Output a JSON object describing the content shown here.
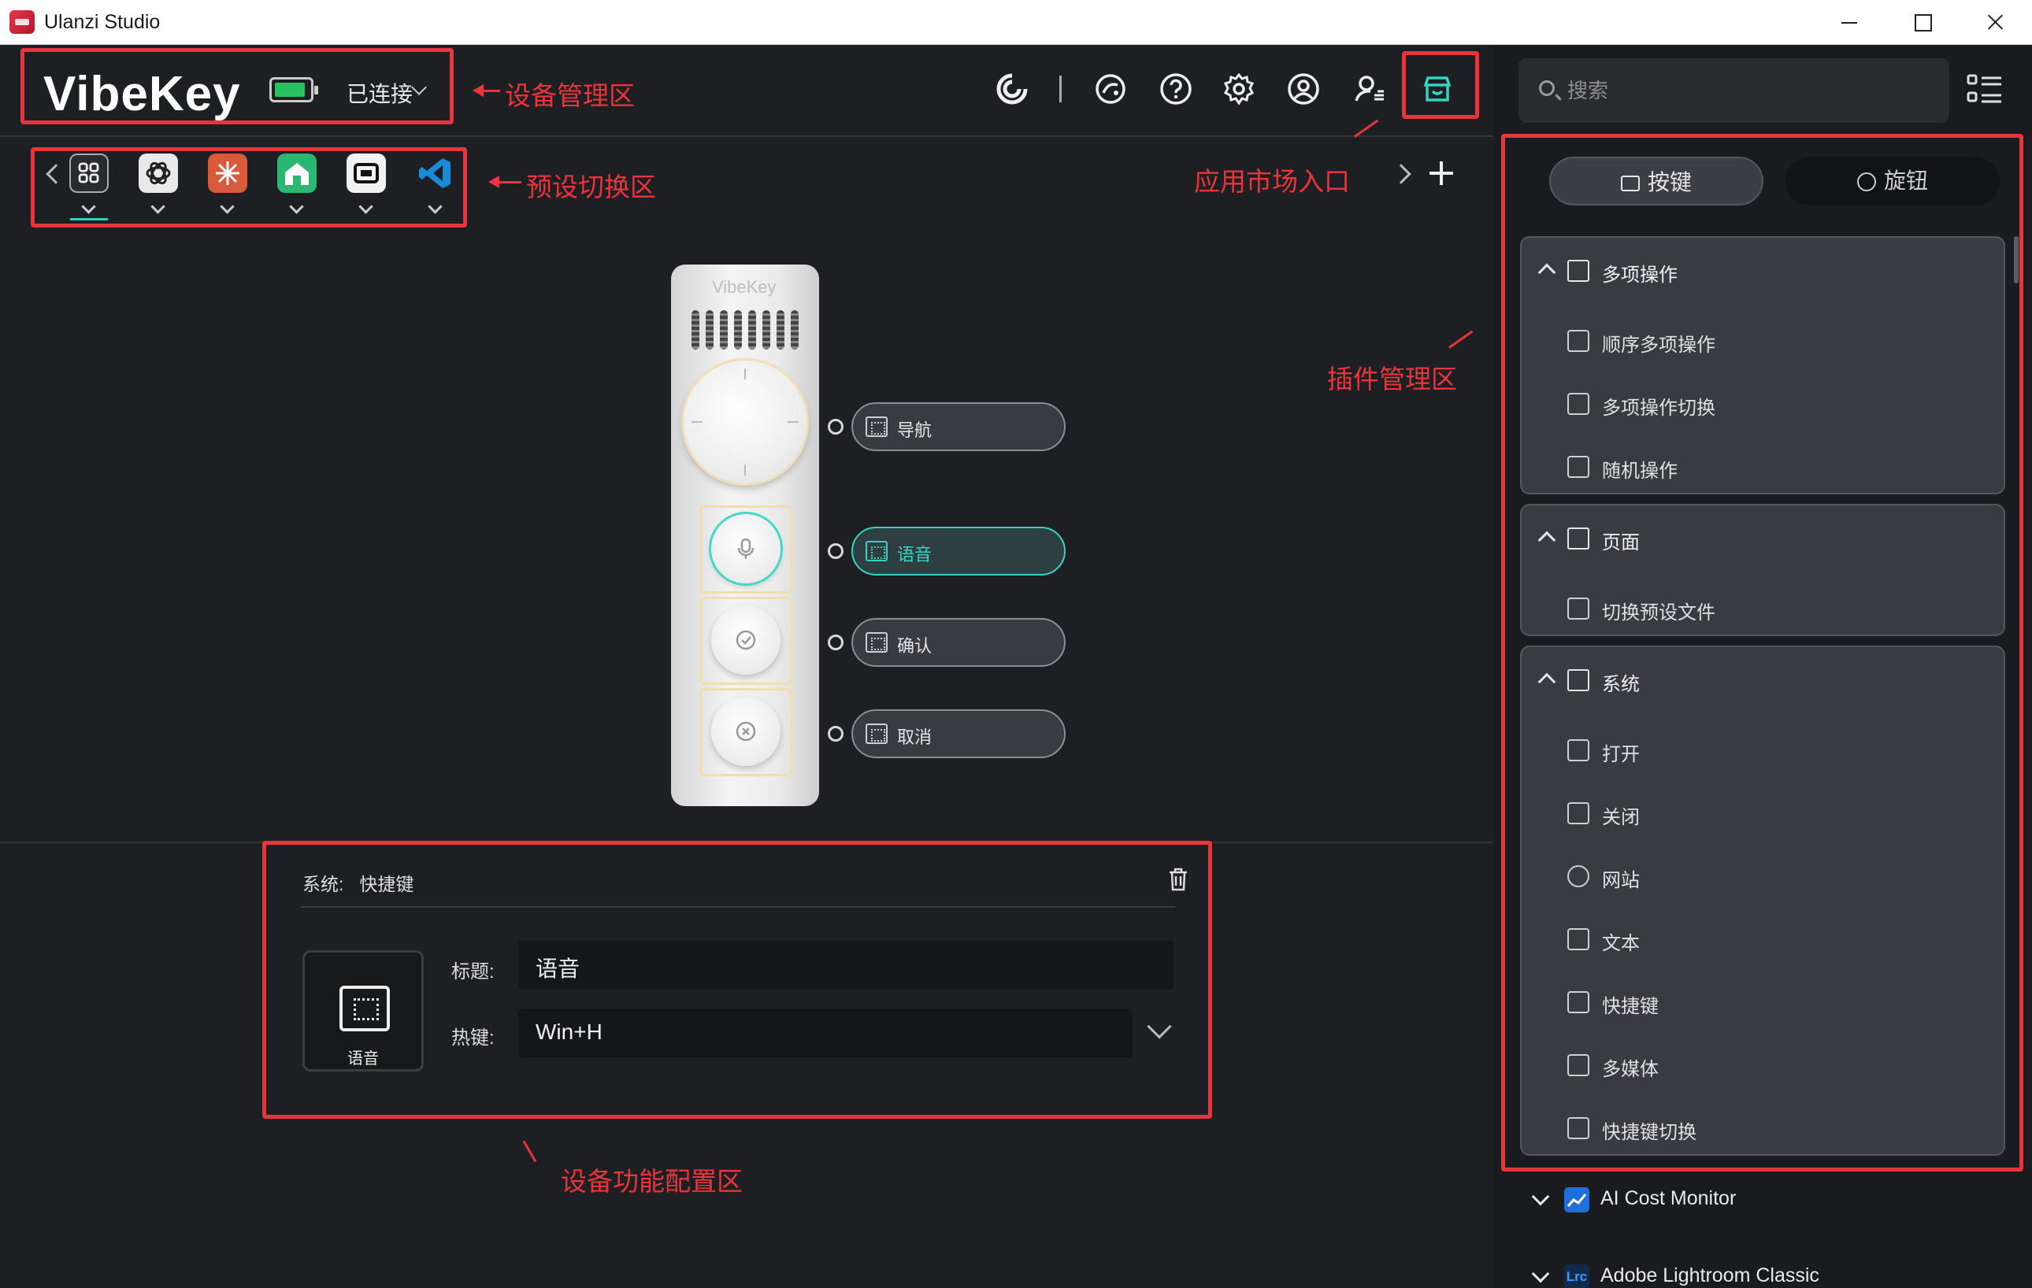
{
  "window": {
    "title": "Ulanzi Studio"
  },
  "device": {
    "brand": "VibeKey",
    "status": "已连接",
    "battery_level": 0.9,
    "device_label": "VibeKey"
  },
  "toolbar": {
    "icons": [
      "ulanzi-logo-icon",
      "community-icon",
      "help-icon",
      "settings-icon",
      "account-icon",
      "user-manage-icon",
      "app-market-icon"
    ]
  },
  "annotations": {
    "device_management": "设备管理区",
    "preset_switch": "预设切换区",
    "app_market_entry": "应用市场入口",
    "plugin_management": "插件管理区",
    "device_config": "设备功能配置区"
  },
  "presets": {
    "items": [
      "grid-preset-icon",
      "openai-preset-icon",
      "claude-preset-icon",
      "green-app-preset-icon",
      "terminal-preset-icon",
      "vscode-preset-icon"
    ],
    "active_index": 0
  },
  "slots": [
    {
      "label": "导航",
      "active": false
    },
    {
      "label": "语音",
      "active": true
    },
    {
      "label": "确认",
      "active": false
    },
    {
      "label": "取消",
      "active": false
    }
  ],
  "config": {
    "system_label": "系统:",
    "action_name": "快捷键",
    "thumbnail_caption": "语音",
    "title_label": "标题:",
    "title_value": "语音",
    "hotkey_label": "热键:",
    "hotkey_value": "Win+H"
  },
  "sidebar": {
    "search_placeholder": "搜索",
    "tabs": [
      {
        "label": "按键",
        "active": true
      },
      {
        "label": "旋钮",
        "active": false
      }
    ],
    "groups": [
      {
        "title": "多项操作",
        "items": [
          "顺序多项操作",
          "多项操作切换",
          "随机操作"
        ]
      },
      {
        "title": "页面",
        "items": [
          "切换预设文件"
        ]
      },
      {
        "title": "系统",
        "items": [
          "打开",
          "关闭",
          "网站",
          "文本",
          "快捷键",
          "多媒体",
          "快捷键切换"
        ]
      }
    ],
    "plugins": [
      {
        "name": "AI Cost Monitor",
        "icon": "chart-line-icon",
        "color": "#1e6fd9"
      },
      {
        "name": "Adobe Lightroom Classic",
        "icon": "lrc-icon",
        "color": "#0f2a4a"
      }
    ]
  },
  "colors": {
    "accent": "#36d3c3",
    "annotation_red": "#e8353b",
    "background": "#1e1f22"
  }
}
